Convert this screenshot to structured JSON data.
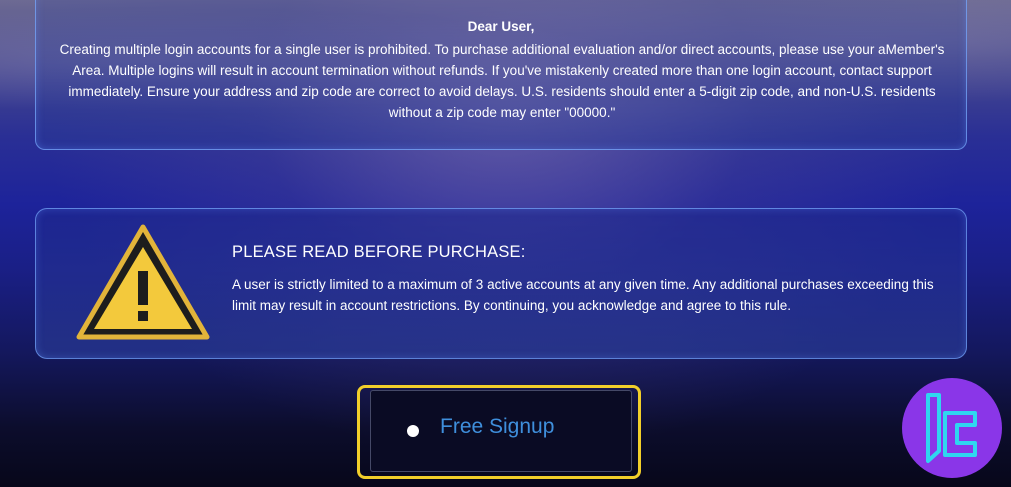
{
  "notice": {
    "title": "Dear User,",
    "body": "Creating multiple login accounts for a single user is prohibited. To purchase additional evaluation and/or direct accounts, please use your aMember's Area. Multiple logins will result in account termination without refunds. If you've mistakenly created more than one login account, contact support immediately. Ensure your address and zip code are correct to avoid delays. U.S. residents should enter a 5-digit zip code, and non-U.S. residents without a zip code may enter \"00000.\""
  },
  "warning": {
    "icon": "warning-triangle-icon",
    "heading": "PLEASE READ BEFORE PURCHASE:",
    "body": "A user is strictly limited to a maximum of 3 active accounts at any given time. Any additional purchases exceeding this limit may result in account restrictions. By continuing, you acknowledge and agree to this rule."
  },
  "signup": {
    "label": "Free Signup",
    "highlight_color": "#f2cf2a",
    "label_color": "#3f8fdc"
  },
  "logo": {
    "icon": "brand-logo-icon",
    "badge_color": "#8a36e8",
    "mark_color": "#2fd6f0"
  }
}
